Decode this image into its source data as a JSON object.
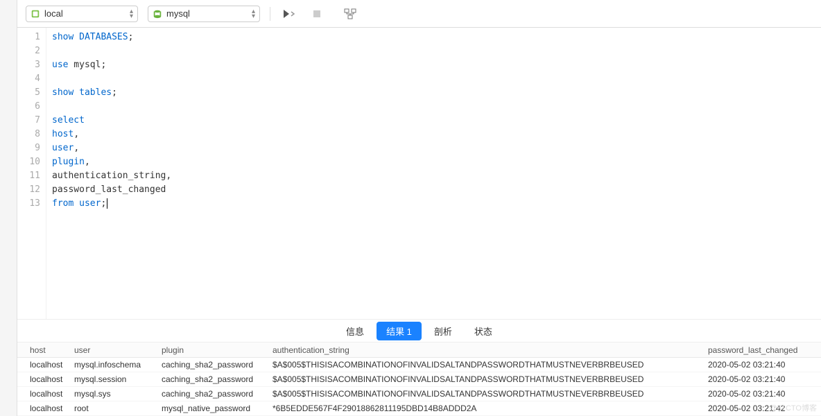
{
  "toolbar": {
    "connection": "local",
    "schema": "mysql"
  },
  "editor": {
    "lines": [
      {
        "n": "1",
        "tokens": [
          {
            "t": "show",
            "c": "kw"
          },
          {
            "t": " "
          },
          {
            "t": "DATABASES",
            "c": "kw"
          },
          {
            "t": ";"
          }
        ]
      },
      {
        "n": "2",
        "tokens": []
      },
      {
        "n": "3",
        "tokens": [
          {
            "t": "use",
            "c": "kw"
          },
          {
            "t": " mysql;"
          }
        ]
      },
      {
        "n": "4",
        "tokens": []
      },
      {
        "n": "5",
        "tokens": [
          {
            "t": "show",
            "c": "kw"
          },
          {
            "t": " "
          },
          {
            "t": "tables",
            "c": "kw"
          },
          {
            "t": ";"
          }
        ]
      },
      {
        "n": "6",
        "tokens": []
      },
      {
        "n": "7",
        "tokens": [
          {
            "t": "select",
            "c": "kw"
          }
        ]
      },
      {
        "n": "8",
        "tokens": [
          {
            "t": "host",
            "c": "kw"
          },
          {
            "t": ","
          }
        ]
      },
      {
        "n": "9",
        "tokens": [
          {
            "t": "user",
            "c": "kw"
          },
          {
            "t": ","
          }
        ]
      },
      {
        "n": "10",
        "tokens": [
          {
            "t": "plugin",
            "c": "kw"
          },
          {
            "t": ","
          }
        ]
      },
      {
        "n": "11",
        "tokens": [
          {
            "t": "authentication_string,"
          }
        ]
      },
      {
        "n": "12",
        "tokens": [
          {
            "t": "password_last_changed"
          }
        ]
      },
      {
        "n": "13",
        "tokens": [
          {
            "t": "from",
            "c": "kw"
          },
          {
            "t": " "
          },
          {
            "t": "user",
            "c": "kw"
          },
          {
            "t": ";"
          }
        ],
        "cursor": true
      }
    ]
  },
  "tabs": {
    "info": "信息",
    "result": "结果 1",
    "profile": "剖析",
    "status": "状态"
  },
  "grid": {
    "headers": {
      "host": "host",
      "user": "user",
      "plugin": "plugin",
      "auth": "authentication_string",
      "pwd": "password_last_changed"
    },
    "rows": [
      {
        "host": "localhost",
        "user": "mysql.infoschema",
        "plugin": "caching_sha2_password",
        "auth": "$A$005$THISISACOMBINATIONOFINVALIDSALTANDPASSWORDTHATMUSTNEVERBRBEUSED",
        "pwd": "2020-05-02 03:21:40"
      },
      {
        "host": "localhost",
        "user": "mysql.session",
        "plugin": "caching_sha2_password",
        "auth": "$A$005$THISISACOMBINATIONOFINVALIDSALTANDPASSWORDTHATMUSTNEVERBRBEUSED",
        "pwd": "2020-05-02 03:21:40"
      },
      {
        "host": "localhost",
        "user": "mysql.sys",
        "plugin": "caching_sha2_password",
        "auth": "$A$005$THISISACOMBINATIONOFINVALIDSALTANDPASSWORDTHATMUSTNEVERBRBEUSED",
        "pwd": "2020-05-02 03:21:40"
      },
      {
        "host": "localhost",
        "user": "root",
        "plugin": "mysql_native_password",
        "auth": "*6B5EDDE567F4F29018862811195DBD14B8ADDD2A",
        "pwd": "2020-05-02 03:21:42"
      }
    ]
  },
  "watermark": "@51CTO博客"
}
